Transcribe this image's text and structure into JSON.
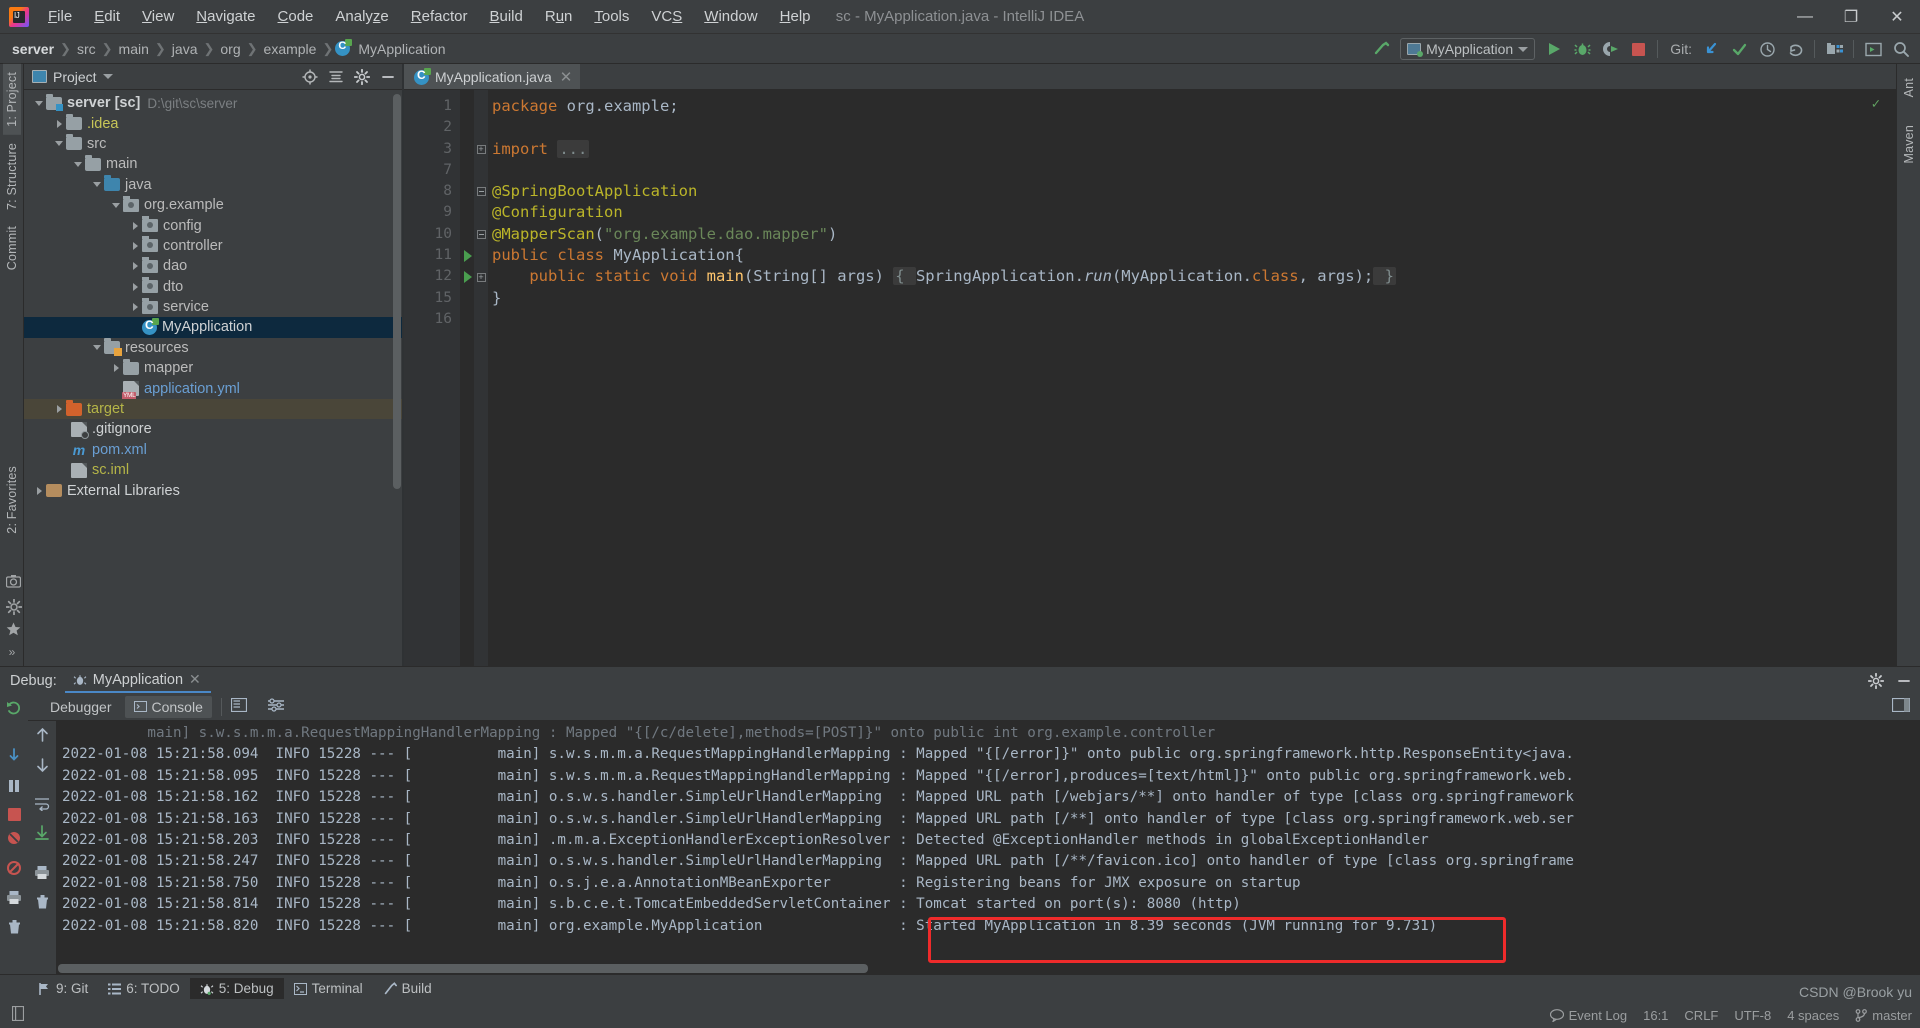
{
  "window": {
    "title": "sc - MyApplication.java - IntelliJ IDEA",
    "minimize": "—",
    "maximize": "❐",
    "close": "✕"
  },
  "menu": [
    {
      "label": "File"
    },
    {
      "label": "Edit"
    },
    {
      "label": "View"
    },
    {
      "label": "Navigate"
    },
    {
      "label": "Code"
    },
    {
      "label": "Analyze"
    },
    {
      "label": "Refactor"
    },
    {
      "label": "Build"
    },
    {
      "label": "Run"
    },
    {
      "label": "Tools"
    },
    {
      "label": "VCS"
    },
    {
      "label": "Window"
    },
    {
      "label": "Help"
    }
  ],
  "breadcrumbs": [
    {
      "label": "server",
      "type": "module"
    },
    {
      "label": "src",
      "type": "folder"
    },
    {
      "label": "main",
      "type": "folder"
    },
    {
      "label": "java",
      "type": "folder"
    },
    {
      "label": "org",
      "type": "folder"
    },
    {
      "label": "example",
      "type": "folder"
    },
    {
      "label": "MyApplication",
      "type": "class"
    }
  ],
  "toolbar": {
    "run_config": "MyApplication",
    "git_label": "Git:",
    "icons": [
      "build-hammer-icon",
      "run-icon",
      "debug-icon",
      "run-coverage-icon",
      "stop-icon",
      "git-update-icon",
      "git-commit-icon",
      "git-history-icon",
      "git-rollback-icon",
      "project-structure-icon",
      "terminal-icon",
      "search-everywhere-icon"
    ]
  },
  "left_strip": {
    "tabs": [
      {
        "label": "1: Project",
        "active": true
      },
      {
        "label": "7: Structure",
        "active": false
      },
      {
        "label": "Commit",
        "active": false
      },
      {
        "label": "2: Favorites",
        "active": false
      }
    ],
    "bottom_icons": [
      "camera-icon",
      "gear-icon",
      "star-icon",
      "more-icon"
    ]
  },
  "right_strip": {
    "tabs": [
      {
        "label": "Ant"
      },
      {
        "label": "Maven"
      }
    ]
  },
  "project_panel": {
    "title": "Project",
    "header_icons": [
      "locate-icon",
      "collapse-all-icon",
      "settings-icon",
      "hide-icon"
    ],
    "tree": [
      {
        "indent": 0,
        "arrow": "open",
        "icon": "module-folder",
        "label": "server [sc]",
        "path": "D:\\git\\sc\\server",
        "color": "white",
        "bold": true
      },
      {
        "indent": 1,
        "arrow": "closed",
        "icon": "folder",
        "label": ".idea",
        "color": "olive"
      },
      {
        "indent": 1,
        "arrow": "open",
        "icon": "folder",
        "label": "src",
        "color": "gray"
      },
      {
        "indent": 2,
        "arrow": "open",
        "icon": "folder",
        "label": "main",
        "color": "gray"
      },
      {
        "indent": 3,
        "arrow": "open",
        "icon": "folder-blue",
        "label": "java",
        "color": "gray"
      },
      {
        "indent": 4,
        "arrow": "open",
        "icon": "package",
        "label": "org.example",
        "color": "gray"
      },
      {
        "indent": 5,
        "arrow": "closed",
        "icon": "package",
        "label": "config",
        "color": "gray"
      },
      {
        "indent": 5,
        "arrow": "closed",
        "icon": "package",
        "label": "controller",
        "color": "gray"
      },
      {
        "indent": 5,
        "arrow": "closed",
        "icon": "package",
        "label": "dao",
        "color": "gray"
      },
      {
        "indent": 5,
        "arrow": "closed",
        "icon": "package",
        "label": "dto",
        "color": "gray"
      },
      {
        "indent": 5,
        "arrow": "closed",
        "icon": "package",
        "label": "service",
        "color": "gray"
      },
      {
        "indent": 5,
        "arrow": "none",
        "icon": "java-class",
        "label": "MyApplication",
        "color": "white",
        "selected": true
      },
      {
        "indent": 3,
        "arrow": "open",
        "icon": "folder-res",
        "label": "resources",
        "color": "gray"
      },
      {
        "indent": 4,
        "arrow": "closed",
        "icon": "folder",
        "label": "mapper",
        "color": "gray"
      },
      {
        "indent": 4,
        "arrow": "none",
        "icon": "yml-file",
        "label": "application.yml",
        "color": "blue"
      },
      {
        "indent": 1,
        "arrow": "closed",
        "icon": "folder-orange",
        "label": "target",
        "color": "olive",
        "highlight": true
      },
      {
        "indent": 1,
        "arrow": "none",
        "icon": "git-file",
        "label": ".gitignore",
        "color": "white"
      },
      {
        "indent": 1,
        "arrow": "none",
        "icon": "maven-file",
        "label": "pom.xml",
        "color": "blue"
      },
      {
        "indent": 1,
        "arrow": "none",
        "icon": "iml-file",
        "label": "sc.iml",
        "color": "olive"
      },
      {
        "indent": 0,
        "arrow": "closed",
        "icon": "library",
        "label": "External Libraries",
        "color": "white"
      }
    ]
  },
  "editor": {
    "tab": {
      "label": "MyApplication.java",
      "close": "✕",
      "icon": "java-class-icon"
    },
    "lines": [
      {
        "num": "1",
        "fold": "none",
        "run": false,
        "tokens": [
          {
            "t": "package ",
            "c": "kw"
          },
          {
            "t": "org.example;",
            "c": "plain"
          }
        ]
      },
      {
        "num": "2",
        "fold": "none",
        "run": false,
        "tokens": []
      },
      {
        "num": "3",
        "fold": "plus",
        "run": false,
        "tokens": [
          {
            "t": "import ",
            "c": "kw"
          },
          {
            "t": "...",
            "c": "fold"
          }
        ]
      },
      {
        "num": "7",
        "fold": "none",
        "run": false,
        "tokens": []
      },
      {
        "num": "8",
        "fold": "start",
        "run": false,
        "tokens": [
          {
            "t": "@SpringBootApplication",
            "c": "ann"
          }
        ]
      },
      {
        "num": "9",
        "fold": "none",
        "run": false,
        "tokens": [
          {
            "t": "@Configuration",
            "c": "ann"
          }
        ]
      },
      {
        "num": "10",
        "fold": "end",
        "run": false,
        "tokens": [
          {
            "t": "@MapperScan",
            "c": "ann"
          },
          {
            "t": "(",
            "c": "plain"
          },
          {
            "t": "\"org.example.dao.mapper\"",
            "c": "str"
          },
          {
            "t": ")",
            "c": "plain"
          }
        ]
      },
      {
        "num": "11",
        "fold": "none",
        "run": true,
        "tokens": [
          {
            "t": "public class ",
            "c": "kw"
          },
          {
            "t": "MyApplication{",
            "c": "plain"
          }
        ]
      },
      {
        "num": "12",
        "fold": "plus",
        "run": true,
        "tokens": [
          {
            "t": "    public static void ",
            "c": "kw"
          },
          {
            "t": "main",
            "c": "mtd"
          },
          {
            "t": "(String[] args) ",
            "c": "plain"
          },
          {
            "t": "{ ",
            "c": "fold"
          },
          {
            "t": "SpringApplication.",
            "c": "plain"
          },
          {
            "t": "run",
            "c": "plain"
          },
          {
            "t": "(MyApplication.",
            "c": "plain"
          },
          {
            "t": "class",
            "c": "kw"
          },
          {
            "t": ", args);",
            "c": "plain"
          },
          {
            "t": " }",
            "c": "fold"
          }
        ]
      },
      {
        "num": "15",
        "fold": "none",
        "run": false,
        "tokens": [
          {
            "t": "}",
            "c": "plain"
          }
        ]
      },
      {
        "num": "16",
        "fold": "none",
        "run": false,
        "tokens": []
      }
    ]
  },
  "debug": {
    "title": "Debug:",
    "session_tab": "MyApplication",
    "session_close": "✕",
    "header_icons": [
      "settings-icon",
      "hide-icon"
    ],
    "subtabs": [
      {
        "label": "Debugger",
        "icon": "debugger-icon",
        "active": false
      },
      {
        "label": "Console",
        "icon": "console-icon",
        "active": true
      }
    ],
    "left_tool_icons": [
      "rerun-icon",
      "step-over-icon",
      "pause-icon",
      "step-into-icon",
      "stop-icon",
      "mute-breakpoints-icon",
      "view-breakpoints-icon",
      "settings-icon",
      "trash-icon"
    ],
    "right_tool_icons": [
      "up-icon",
      "down-icon",
      "soft-wrap-icon",
      "scroll-end-icon",
      "print-icon",
      "clear-all-icon"
    ],
    "console_lines": [
      {
        "time": "",
        "text": "          main] s.w.s.m.m.a.RequestMappingHandlerMapping : Mapped \"{[/c/delete],methods=[POST]}\" onto public int org.example.controller",
        "partial": true
      },
      {
        "time": "2022-01-08 15:21:58.094  INFO 15228 --- [",
        "text": "          main] s.w.s.m.m.a.RequestMappingHandlerMapping : Mapped \"{[/error]}\" onto public org.springframework.http.ResponseEntity<java."
      },
      {
        "time": "2022-01-08 15:21:58.095  INFO 15228 --- [",
        "text": "          main] s.w.s.m.m.a.RequestMappingHandlerMapping : Mapped \"{[/error],produces=[text/html]}\" onto public org.springframework.web."
      },
      {
        "time": "2022-01-08 15:21:58.162  INFO 15228 --- [",
        "text": "          main] o.s.w.s.handler.SimpleUrlHandlerMapping  : Mapped URL path [/webjars/**] onto handler of type [class org.springframework"
      },
      {
        "time": "2022-01-08 15:21:58.163  INFO 15228 --- [",
        "text": "          main] o.s.w.s.handler.SimpleUrlHandlerMapping  : Mapped URL path [/**] onto handler of type [class org.springframework.web.ser"
      },
      {
        "time": "2022-01-08 15:21:58.203  INFO 15228 --- [",
        "text": "          main] .m.m.a.ExceptionHandlerExceptionResolver : Detected @ExceptionHandler methods in globalExceptionHandler"
      },
      {
        "time": "2022-01-08 15:21:58.247  INFO 15228 --- [",
        "text": "          main] o.s.w.s.handler.SimpleUrlHandlerMapping  : Mapped URL path [/**/favicon.ico] onto handler of type [class org.springframe"
      },
      {
        "time": "2022-01-08 15:21:58.750  INFO 15228 --- [",
        "text": "          main] o.s.j.e.a.AnnotationMBeanExporter        : Registering beans for JMX exposure on startup"
      },
      {
        "time": "2022-01-08 15:21:58.814  INFO 15228 --- [",
        "text": "          main] s.b.c.e.t.TomcatEmbeddedServletContainer : Tomcat started on port(s): 8080 (http)"
      },
      {
        "time": "2022-01-08 15:21:58.820  INFO 15228 --- [",
        "text": "          main] org.example.MyApplication                : Started MyApplication in 8.39 seconds (JVM running for 9.731)"
      }
    ],
    "highlight_color": "#ef2b2b"
  },
  "status_tabs": [
    {
      "label": "9: Git",
      "underline": "9",
      "icon": "git-icon",
      "active": false
    },
    {
      "label": "6: TODO",
      "underline": "6",
      "icon": "todo-icon",
      "active": false
    },
    {
      "label": "5: Debug",
      "underline": "5",
      "icon": "debug-icon",
      "active": true
    },
    {
      "label": "Terminal",
      "underline": "",
      "icon": "terminal-icon",
      "active": false
    },
    {
      "label": "Build",
      "underline": "",
      "icon": "build-icon",
      "active": false
    }
  ],
  "status_bar": {
    "left": "",
    "event_log": "Event Log",
    "caret": "16:1",
    "line_sep": "CRLF",
    "encoding": "UTF-8",
    "indent": "4 spaces",
    "branch": "master",
    "watermark": "CSDN @Brook yu"
  }
}
